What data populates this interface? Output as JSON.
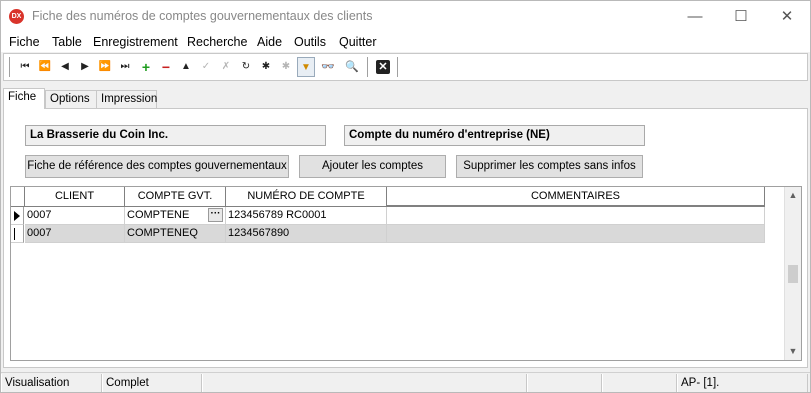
{
  "window": {
    "icon_text": "DX",
    "title": "Fiche des numéros de comptes gouvernementaux des clients",
    "minimize_glyph": "—",
    "maximize_glyph": "☐",
    "close_glyph": "✕"
  },
  "menu": {
    "items": [
      "Fiche",
      "Table",
      "Enregistrement",
      "Recherche",
      "Aide",
      "Outils",
      "Quitter"
    ]
  },
  "toolbar": {
    "buttons": [
      {
        "icon": "first-record-icon",
        "glyph": "⏮"
      },
      {
        "icon": "previous-page-icon",
        "glyph": "⏪"
      },
      {
        "icon": "previous-record-icon",
        "glyph": "◀"
      },
      {
        "icon": "next-record-icon",
        "glyph": "▶"
      },
      {
        "icon": "next-page-icon",
        "glyph": "⏩"
      },
      {
        "icon": "last-record-icon",
        "glyph": "⏭"
      },
      {
        "icon": "add-icon",
        "glyph": "+"
      },
      {
        "icon": "delete-icon",
        "glyph": "−"
      },
      {
        "icon": "edit-up-icon",
        "glyph": "▲"
      },
      {
        "icon": "confirm-icon",
        "glyph": "✓"
      },
      {
        "icon": "cancel-icon",
        "glyph": "✗"
      },
      {
        "icon": "refresh-icon",
        "glyph": "↻"
      },
      {
        "icon": "asterisk-icon",
        "glyph": "✱"
      },
      {
        "icon": "asterisk-disabled-icon",
        "glyph": "✱"
      },
      {
        "icon": "filter-icon",
        "glyph": "▼"
      },
      {
        "icon": "binoculars-icon",
        "glyph": "👓"
      },
      {
        "icon": "search-icon",
        "glyph": "🔍"
      },
      {
        "icon": "close-form-icon",
        "glyph": "✕"
      }
    ]
  },
  "tabs": [
    "Fiche",
    "Options",
    "Impression"
  ],
  "form": {
    "client_name": "La Brasserie du Coin Inc.",
    "account_type": "Compte du numéro d'entreprise (NE)",
    "btn_reference": "Fiche de référence des comptes gouvernementaux",
    "btn_add": "Ajouter les comptes",
    "btn_delete": "Supprimer les comptes sans infos"
  },
  "grid": {
    "columns": [
      "CLIENT",
      "COMPTE GVT.",
      "NUMÉRO DE COMPTE",
      "COMMENTAIRES"
    ],
    "rows": [
      {
        "client": "0007",
        "compte": "COMPTENE",
        "numero": "123456789 RC0001",
        "commentaires": ""
      },
      {
        "client": "0007",
        "compte": "COMPTENEQ",
        "numero": "1234567890",
        "commentaires": ""
      }
    ],
    "ellipsis": "···",
    "scroll_up": "▲",
    "scroll_down": "▼"
  },
  "status": {
    "mode": "Visualisation",
    "state": "Complet",
    "position": "AP- [1]."
  }
}
